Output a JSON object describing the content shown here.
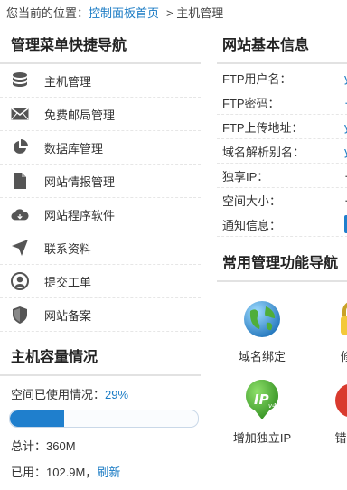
{
  "breadcrumb": {
    "prefix": "您当前的位置：",
    "link": "控制面板首页",
    "sep": "->",
    "current": "主机管理"
  },
  "left": {
    "title": "管理菜单快捷导航",
    "menu": [
      {
        "label": "主机管理",
        "icon": "database-icon"
      },
      {
        "label": "免费邮局管理",
        "icon": "mail-icon"
      },
      {
        "label": "数据库管理",
        "icon": "pie-chart-icon"
      },
      {
        "label": "网站情报管理",
        "icon": "document-icon"
      },
      {
        "label": "网站程序软件",
        "icon": "cloud-icon"
      },
      {
        "label": "联系资料",
        "icon": "send-icon"
      },
      {
        "label": "提交工单",
        "icon": "user-icon"
      },
      {
        "label": "网站备案",
        "icon": "shield-icon"
      }
    ]
  },
  "capacity": {
    "title": "主机容量情况",
    "usage_label": "空间已使用情况：",
    "usage_pct": "29%",
    "usage_fraction": 0.29,
    "total": "总计：360M",
    "used": "已用：102.9M，",
    "refresh": "刷新"
  },
  "site_info": {
    "title": "网站基本信息",
    "rows": [
      {
        "key": "FTP用户名："
      },
      {
        "key": "FTP密码："
      },
      {
        "key": "FTP上传地址："
      },
      {
        "key": "域名解析别名："
      },
      {
        "key": "独享IP："
      },
      {
        "key": "空间大小："
      },
      {
        "key": "通知信息："
      }
    ]
  },
  "tools": {
    "title": "常用管理功能导航",
    "items": [
      {
        "label": "域名绑定",
        "icon": "globe-icon"
      },
      {
        "label": "修改",
        "icon": "lock-icon"
      },
      {
        "label": "增加独立IP",
        "icon": "ipv4-icon"
      },
      {
        "label": "错误页",
        "icon": "error-page-icon"
      }
    ]
  },
  "colors": {
    "accent": "#1a7bc4",
    "progress": "#1f7fcd",
    "icon_gray": "#5a5a5a"
  }
}
